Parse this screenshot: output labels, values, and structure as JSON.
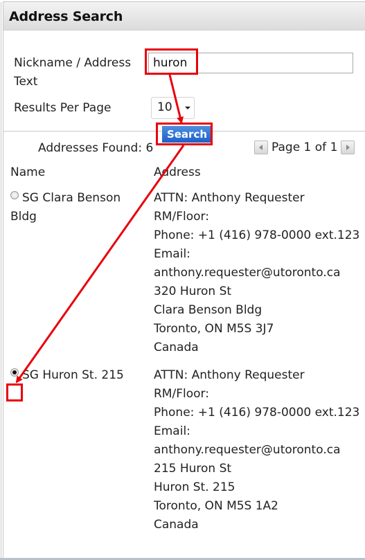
{
  "header": {
    "title": "Address Search"
  },
  "form": {
    "nickname_label": "Nickname / Address Text",
    "nickname_value": "huron",
    "results_per_page_label": "Results Per Page",
    "results_per_page_value": "10",
    "search_button": "Search"
  },
  "results": {
    "found_label": "Addresses Found: 6",
    "pager_text": "Page 1 of 1",
    "columns": {
      "name": "Name",
      "address": "Address"
    },
    "rows": [
      {
        "name": "SG Clara Benson Bldg",
        "selected": false,
        "address": [
          "ATTN: Anthony Requester",
          "RM/Floor:",
          "Phone: +1 (416) 978-0000 ext.123",
          "Email:",
          "anthony.requester@utoronto.ca",
          "320 Huron St",
          "Clara Benson Bldg",
          "Toronto, ON M5S 3J7",
          "Canada"
        ]
      },
      {
        "name": "SG Huron St. 215",
        "selected": true,
        "address": [
          "ATTN: Anthony Requester",
          "RM/Floor:",
          "Phone: +1 (416) 978-0000 ext.123",
          "Email:",
          "anthony.requester@utoronto.ca",
          "215 Huron St",
          "Huron St. 215",
          "Toronto, ON M5S 1A2",
          "Canada"
        ]
      }
    ]
  },
  "annotations": {
    "highlight_color": "#e8000b"
  }
}
